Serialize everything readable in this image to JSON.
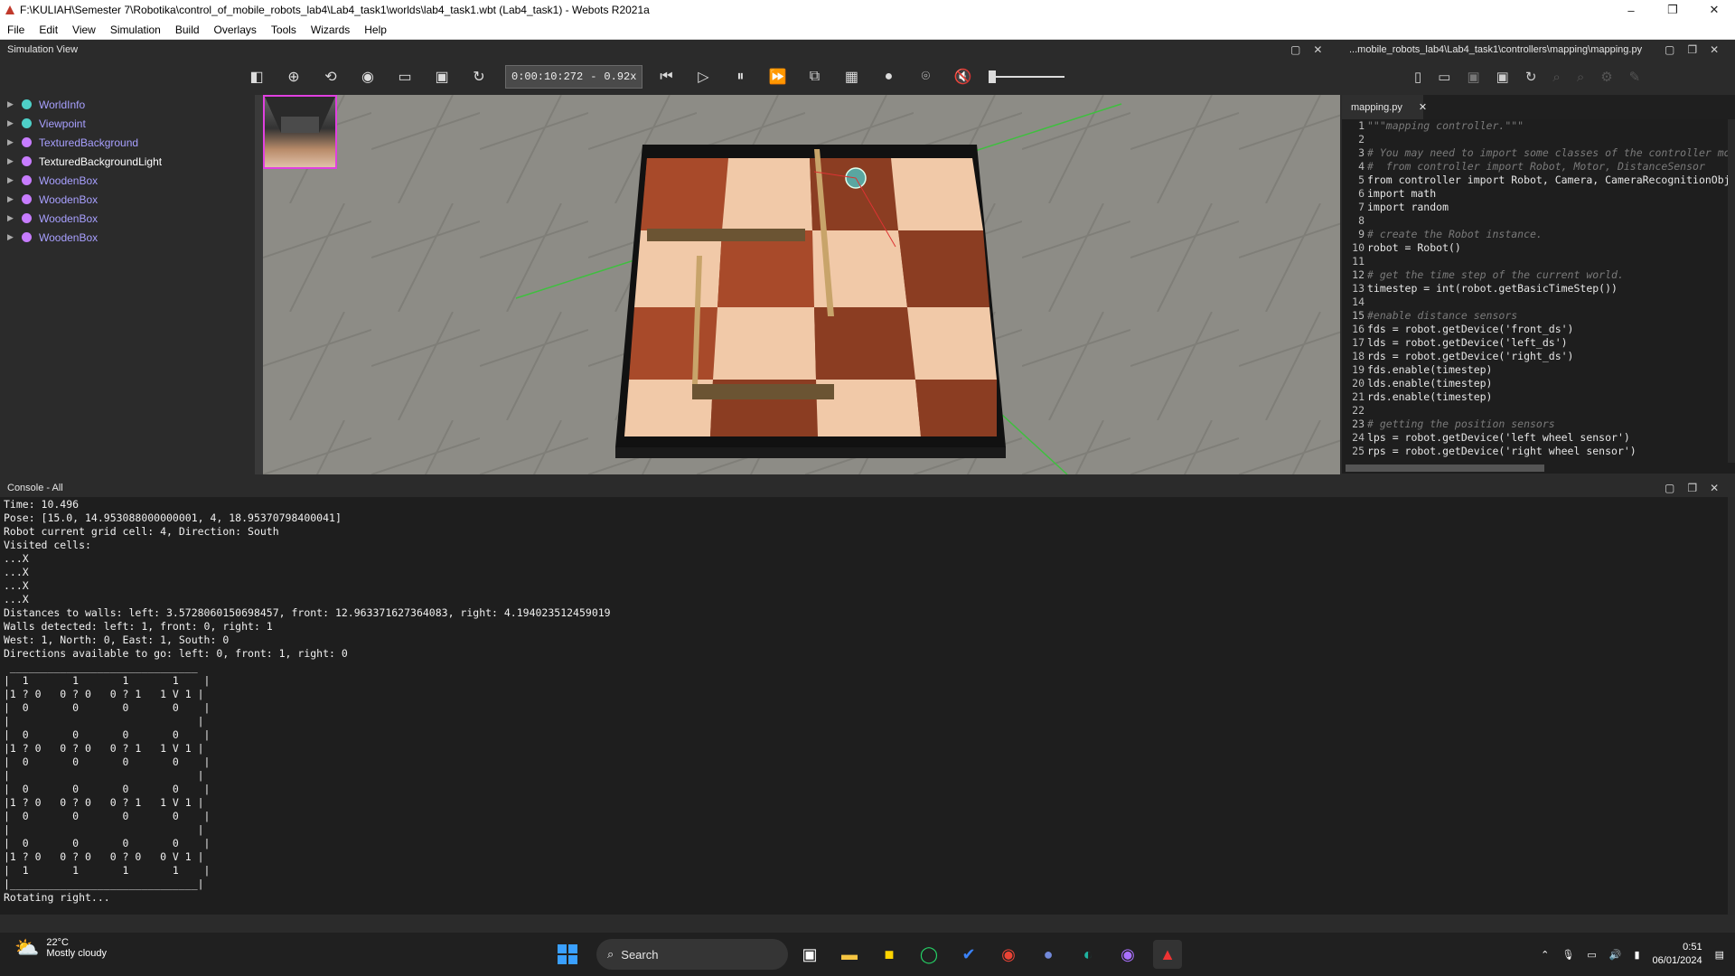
{
  "window": {
    "title": "F:\\KULIAH\\Semester 7\\Robotika\\control_of_mobile_robots_lab4\\Lab4_task1\\worlds\\lab4_task1.wbt (Lab4_task1) - Webots R2021a",
    "controls": [
      "–",
      "❐",
      "✕"
    ]
  },
  "menu": [
    "File",
    "Edit",
    "View",
    "Simulation",
    "Build",
    "Overlays",
    "Tools",
    "Wizards",
    "Help"
  ],
  "simulation_view": {
    "title": "Simulation View",
    "time": "0:00:10:272",
    "time_sep": "-",
    "speed": "0.92x"
  },
  "scene_tree": [
    {
      "label": "WorldInfo",
      "color": "#4ed0c8"
    },
    {
      "label": "Viewpoint",
      "color": "#4ed0c8"
    },
    {
      "label": "TexturedBackground",
      "color": "#c77cff"
    },
    {
      "label": "TexturedBackgroundLight",
      "color": "#c77cff"
    },
    {
      "label": "WoodenBox",
      "color": "#c77cff"
    },
    {
      "label": "WoodenBox",
      "color": "#c77cff"
    },
    {
      "label": "WoodenBox",
      "color": "#c77cff"
    },
    {
      "label": "WoodenBox",
      "color": "#c77cff"
    }
  ],
  "editor": {
    "path": "...mobile_robots_lab4\\Lab4_task1\\controllers\\mapping\\mapping.py",
    "tab": "mapping.py",
    "lines": [
      "\"\"\"mapping controller.\"\"\"",
      "",
      "# You may need to import some classes of the controller module. Ex:",
      "#  from controller import Robot, Motor, DistanceSensor",
      "from controller import Robot, Camera, CameraRecognitionObject",
      "import math",
      "import random",
      "",
      "# create the Robot instance.",
      "robot = Robot()",
      "",
      "# get the time step of the current world.",
      "timestep = int(robot.getBasicTimeStep())",
      "",
      "#enable distance sensors",
      "fds = robot.getDevice('front_ds')",
      "lds = robot.getDevice('left_ds')",
      "rds = robot.getDevice('right_ds')",
      "fds.enable(timestep)",
      "lds.enable(timestep)",
      "rds.enable(timestep)",
      "",
      "# getting the position sensors",
      "lps = robot.getDevice('left wheel sensor')",
      "rps = robot.getDevice('right wheel sensor')"
    ]
  },
  "console": {
    "title": "Console - All",
    "lines": [
      "Time: 10.496",
      "Pose: [15.0, 14.953088000000001, 4, 18.95370798400041]",
      "Robot current grid cell: 4, Direction: South",
      "Visited cells:",
      "...X",
      "...X",
      "...X",
      "...X",
      "Distances to walls: left: 3.5728060150698457, front: 12.963371627364083, right: 4.194023512459019",
      "Walls detected: left: 1, front: 0, right: 1",
      "West: 1, North: 0, East: 1, South: 0",
      "Directions available to go: left: 0, front: 1, right: 0",
      " ______________________________",
      "|  1       1       1       1    |",
      "|1 ? 0   0 ? 0   0 ? 1   1 V 1 |",
      "|  0       0       0       0    |",
      "|                              |",
      "|  0       0       0       0    |",
      "|1 ? 0   0 ? 0   0 ? 1   1 V 1 |",
      "|  0       0       0       0    |",
      "|                              |",
      "|  0       0       0       0    |",
      "|1 ? 0   0 ? 0   0 ? 1   1 V 1 |",
      "|  0       0       0       0    |",
      "|                              |",
      "|  0       0       0       0    |",
      "|1 ? 0   0 ? 0   0 ? 0   0 V 1 |",
      "|  1       1       1       1    |",
      "|______________________________|",
      "Rotating right..."
    ]
  },
  "taskbar": {
    "temperature": "22°C",
    "weather": "Mostly cloudy",
    "search_placeholder": "Search",
    "time": "0:51",
    "date": "06/01/2024"
  }
}
